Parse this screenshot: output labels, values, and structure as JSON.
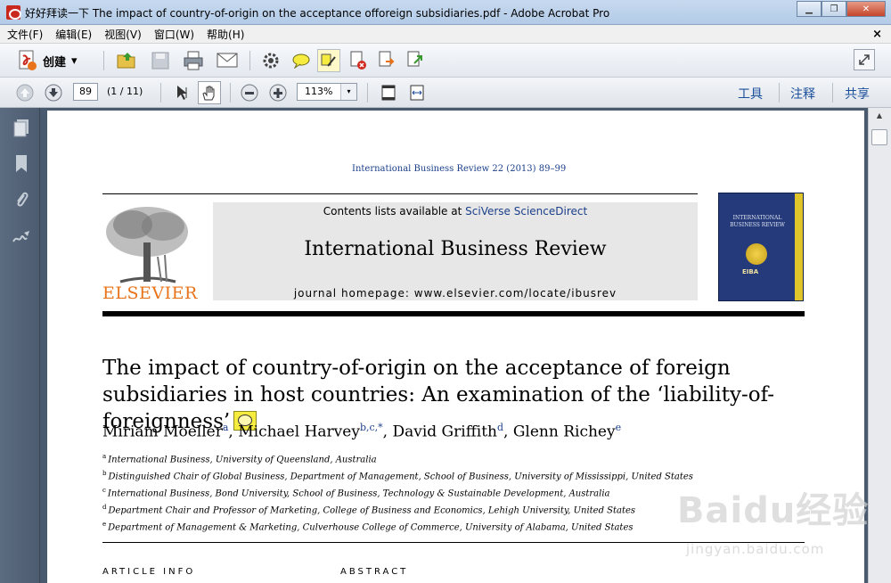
{
  "window": {
    "title": "好好拜读一下 The impact of country-of-origin on the acceptance offoreign subsidiaries.pdf - Adobe Acrobat Pro",
    "minimize_glyph": "▁",
    "restore_glyph": "❐",
    "close_glyph": "✕"
  },
  "menu": {
    "items": [
      "文件(F)",
      "编辑(E)",
      "视图(V)",
      "窗口(W)",
      "帮助(H)"
    ],
    "close_glyph": "×"
  },
  "toolbar": {
    "create_label": "创建",
    "create_arrow": "▾"
  },
  "navbar": {
    "page_value": "89",
    "page_count": "(1 / 11)",
    "zoom_value": "113%",
    "zoom_arrow": "▾",
    "tools_label": "工具",
    "comment_label": "注释",
    "share_label": "共享"
  },
  "document": {
    "journal_ref": "International Business Review 22 (2013) 89–99",
    "contents_prefix": "Contents lists available at ",
    "contents_link": "SciVerse ScienceDirect",
    "journal_title": "International Business Review",
    "homepage": "journal homepage: www.elsevier.com/locate/ibusrev",
    "publisher": "ELSEVIER",
    "cover_text": "INTERNATIONAL BUSINESS REVIEW",
    "cover_badge": "EIBA",
    "article_title": "The impact of country-of-origin on the acceptance of foreign subsidiaries in host countries: An examination of the ‘liability-of-foreignness’",
    "authors": [
      {
        "name": "Miriam Moeller",
        "sup": "a",
        "sep": ", "
      },
      {
        "name": "Michael Harvey",
        "sup": "b,c,*",
        "sep": ", "
      },
      {
        "name": "David Griffith",
        "sup": "d",
        "sep": ", "
      },
      {
        "name": "Glenn Richey",
        "sup": "e",
        "sep": ""
      }
    ],
    "affiliations": [
      {
        "sup": "a",
        "text": "International Business, University of Queensland, Australia"
      },
      {
        "sup": "b",
        "text": "Distinguished Chair of Global Business, Department of Management, School of Business, University of Mississippi, United States"
      },
      {
        "sup": "c",
        "text": "International Business, Bond University, School of Business, Technology & Sustainable Development, Australia"
      },
      {
        "sup": "d",
        "text": "Department Chair and Professor of Marketing, College of Business and Economics, Lehigh University, United States"
      },
      {
        "sup": "e",
        "text": "Department of Management & Marketing, Culverhouse College of Commerce, University of Alabama, United States"
      }
    ],
    "article_info_label": "ARTICLE INFO",
    "abstract_label": "ABSTRACT"
  },
  "scrollbar": {
    "up_glyph": "▲"
  },
  "watermark": {
    "main": "Baidu经验",
    "sub": "jingyan.baidu.com"
  }
}
